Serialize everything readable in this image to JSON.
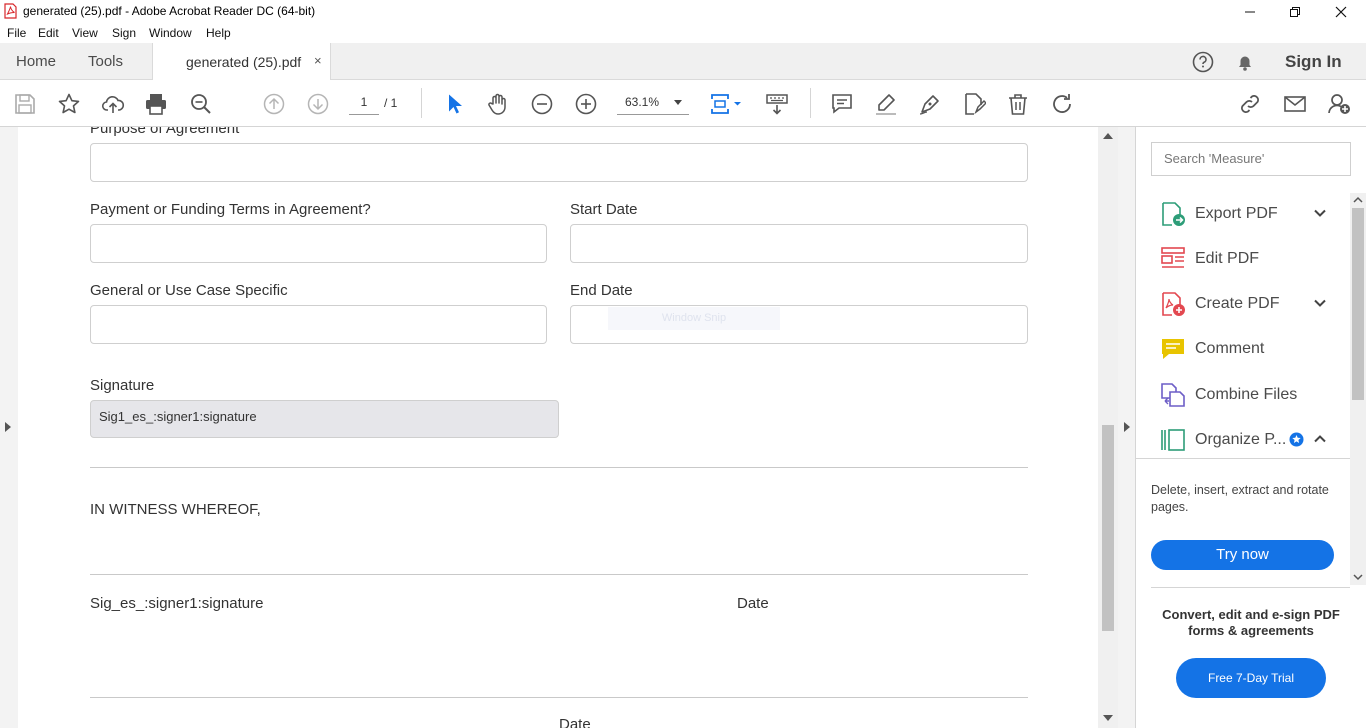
{
  "window": {
    "title": "generated (25).pdf - Adobe Acrobat Reader DC (64-bit)"
  },
  "menu": [
    "File",
    "Edit",
    "View",
    "Sign",
    "Window",
    "Help"
  ],
  "tabs": {
    "home": "Home",
    "tools": "Tools",
    "document": "generated (25).pdf",
    "close": "×",
    "signin": "Sign In"
  },
  "toolbar": {
    "page_current": "1",
    "page_total": "/ 1",
    "zoom": "63.1%"
  },
  "document": {
    "purpose_label": "Purpose of Agreement",
    "payment_label": "Payment or Funding Terms in Agreement?",
    "start_date_label": "Start Date",
    "general_label": "General or Use Case Specific",
    "end_date_label": "End Date",
    "watermark": "Window Snip",
    "signature_label": "Signature",
    "signature_field": "Sig1_es_:signer1:signature",
    "witness": "IN WITNESS WHEREOF,",
    "sig_line": "Sig_es_:signer1:signature",
    "date_1": "Date",
    "date_2": "Date"
  },
  "right_pane": {
    "search_placeholder": "Search 'Measure'",
    "tools": [
      {
        "label": "Export PDF",
        "icon": "export-pdf-icon",
        "color": "#2d9d78"
      },
      {
        "label": "Edit PDF",
        "icon": "edit-pdf-icon",
        "color": "#e34850"
      },
      {
        "label": "Create PDF",
        "icon": "create-pdf-icon",
        "color": "#e34850"
      },
      {
        "label": "Comment",
        "icon": "comment-icon",
        "color": "#e8c400"
      },
      {
        "label": "Combine Files",
        "icon": "combine-files-icon",
        "color": "#6d5ec7"
      },
      {
        "label": "Organize P...",
        "icon": "organize-pages-icon",
        "color": "#2d9d78"
      }
    ],
    "promo_desc": "Delete, insert, extract and rotate pages.",
    "try_now": "Try now",
    "promo_title": "Convert, edit and e-sign PDF forms & agreements",
    "free_trial": "Free 7-Day Trial"
  },
  "colors": {
    "accent": "#1473e6",
    "toolbar_icon": "#555555",
    "select_tool": "#1473e6"
  }
}
